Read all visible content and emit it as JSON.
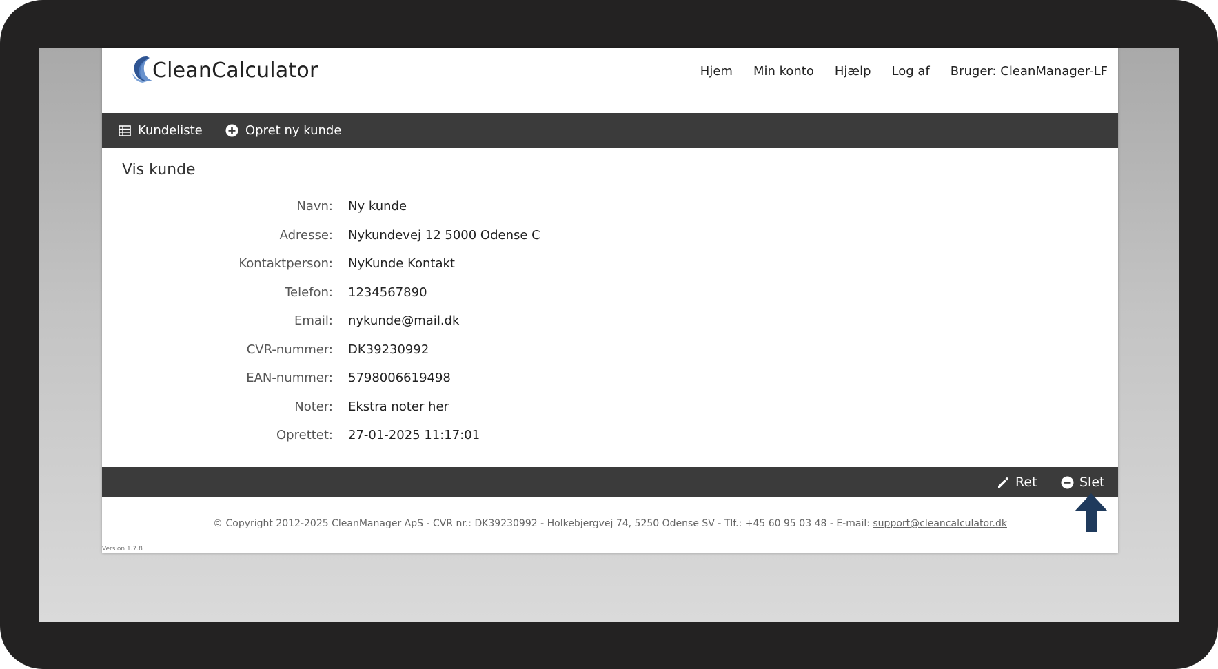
{
  "brand": {
    "name": "CleanCalculator"
  },
  "topnav": {
    "items": [
      "Hjem",
      "Min konto",
      "Hjælp",
      "Log af"
    ],
    "user": "Bruger: CleanManager-LF"
  },
  "toolbar": {
    "customer_list": {
      "label": "Kundeliste",
      "icon": "table-icon"
    },
    "create_customer": {
      "label": "Opret ny kunde",
      "icon": "plus-circle-icon"
    }
  },
  "section": {
    "title": "Vis kunde"
  },
  "customer": {
    "fields": [
      {
        "label": "Navn:",
        "value": "Ny kunde"
      },
      {
        "label": "Adresse:",
        "value": "Nykundevej 12 5000 Odense C"
      },
      {
        "label": "Kontaktperson:",
        "value": "NyKunde Kontakt"
      },
      {
        "label": "Telefon:",
        "value": "1234567890"
      },
      {
        "label": "Email:",
        "value": "nykunde@mail.dk"
      },
      {
        "label": "CVR-nummer:",
        "value": "DK39230992"
      },
      {
        "label": "EAN-nummer:",
        "value": "5798006619498"
      },
      {
        "label": "Noter:",
        "value": "Ekstra noter her"
      },
      {
        "label": "Oprettet:",
        "value": "27-01-2025 11:17:01"
      }
    ]
  },
  "actions": {
    "edit": {
      "label": "Ret",
      "icon": "pencil-icon"
    },
    "delete": {
      "label": "Slet",
      "icon": "minus-circle-icon"
    }
  },
  "footer": {
    "text": "© Copyright 2012-2025 CleanManager ApS - CVR nr.: DK39230992 - Holkebjergvej 74, 5250 Odense SV - Tlf.: +45 60 95 03 48 - E-mail: ",
    "email": "support@cleancalculator.dk",
    "version": "Version 1.7.8"
  },
  "colors": {
    "bar": "#3b3b3b",
    "arrow": "#1f3a5c",
    "logo": "#3d6aa8"
  }
}
